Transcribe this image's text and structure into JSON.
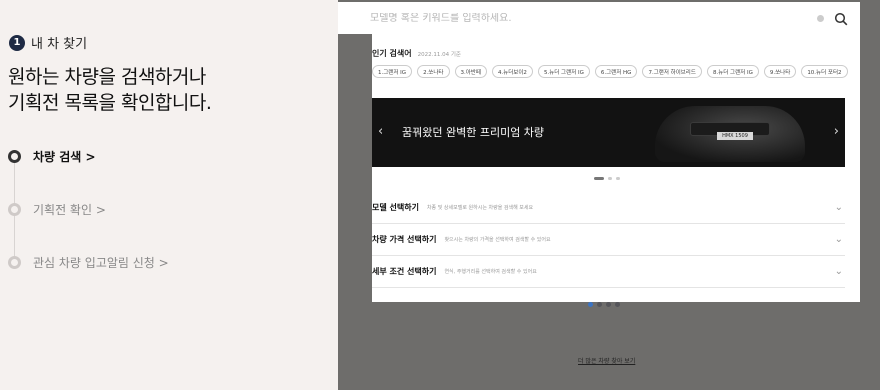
{
  "step": {
    "number": "1",
    "title": "내 차 찾기"
  },
  "headline": {
    "line1": "원하는 차량을 검색하거나",
    "line2": "기획전 목록을 확인합니다."
  },
  "timeline": [
    {
      "label": "차량 검색 >",
      "active": true
    },
    {
      "label": "기획전 확인 >",
      "active": false
    },
    {
      "label": "관심 차량 입고알림 신청 >",
      "active": false
    }
  ],
  "search": {
    "placeholder": "모델명 혹은 키워드를 입력하세요.",
    "icon": "search-icon"
  },
  "popular": {
    "title": "인기 검색어",
    "date": "2022.11.04 기준",
    "keywords": [
      "1.그랜저 IG",
      "2.쏘나타",
      "3.아반떼",
      "4.뉴더보이2",
      "5.뉴더 그랜저 IG",
      "6.그랜저 HG",
      "7.그랜저 하이브리드",
      "8.뉴더 그랜저 IG",
      "9.쏘나타",
      "10.뉴더 포터2"
    ]
  },
  "banner": {
    "text": "꿈꿔왔던 완벽한 프리미엄 차량",
    "plate": "HMX 1509",
    "prev": "‹",
    "next": "›"
  },
  "accordions": [
    {
      "title": "모델 선택하기",
      "desc": "차종 및 상세모델로 원하시는 차량을 검색해 보세요",
      "chevron": "⌄"
    },
    {
      "title": "차량 가격 선택하기",
      "desc": "찾으시는 차량의 가격을 선택하여 검색할 수 있어요",
      "chevron": "⌄"
    },
    {
      "title": "세부 조건 선택하기",
      "desc": "연식, 주행거리를 선택하여 검색할 수 있어요",
      "chevron": "⌄"
    }
  ],
  "more_link": "더 많은 차량 찾아 보기",
  "colors": {
    "accent": "#1e2a44",
    "banner_bg": "#121212",
    "overlay": "#6e6d6b"
  }
}
